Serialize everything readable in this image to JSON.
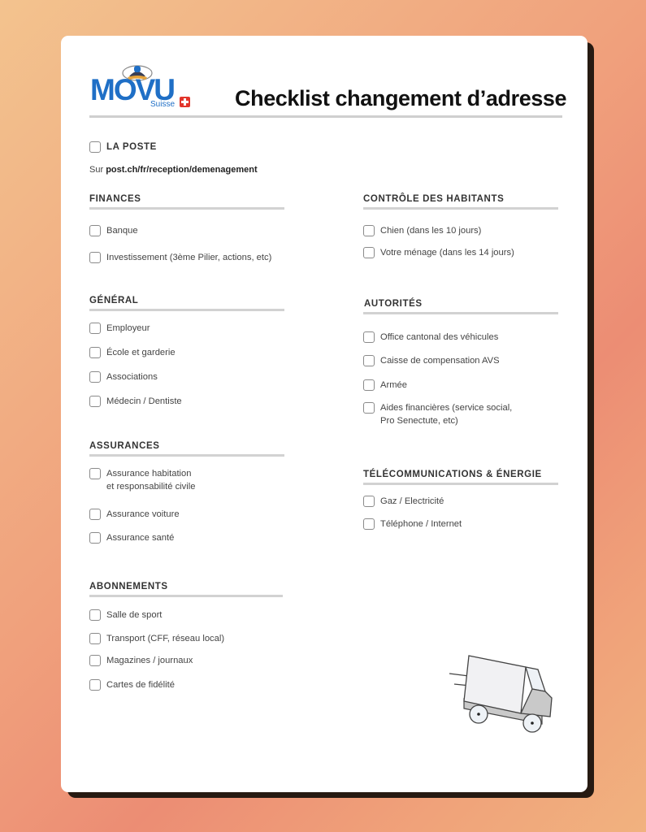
{
  "header": {
    "logo": {
      "brand": "MOVU",
      "sub": "Suisse",
      "brand_color": "#1f6fc6",
      "flag_color": "#e2352b"
    },
    "title": "Checklist changement d’adresse"
  },
  "la_poste": {
    "label": "LA POSTE",
    "note_prefix": "Sur",
    "note_link": "post.ch/fr/reception/demenagement"
  },
  "sections": {
    "finances": {
      "title": "FINANCES",
      "items": [
        "Banque",
        "Investissement (3ème Pilier, actions, etc)"
      ]
    },
    "general": {
      "title": "GÉNÉRAL",
      "items": [
        "Employeur",
        "École et garderie",
        "Associations",
        "Médecin / Dentiste"
      ]
    },
    "assurances": {
      "title": "ASSURANCES",
      "items": [
        "Assurance habitation\net responsabilité civile",
        "Assurance voiture",
        "Assurance santé"
      ]
    },
    "abonnements": {
      "title": "ABONNEMENTS",
      "items": [
        "Salle de sport",
        "Transport (CFF, réseau local)",
        "Magazines / journaux",
        "Cartes de fidélité"
      ]
    },
    "controle": {
      "title": "CONTRÔLE DES HABITANTS",
      "items": [
        "Chien (dans les 10 jours)",
        "Votre ménage (dans les 14 jours)"
      ]
    },
    "autorites": {
      "title": "AUTORITÉS",
      "items": [
        "Office cantonal des véhicules",
        "Caisse de compensation AVS",
        "Armée",
        "Aides financières (service social,\nPro Senectute, etc)"
      ]
    },
    "telecom": {
      "title": "TÉLÉCOMMUNICATIONS & ÉNERGIE",
      "items": [
        "Gaz / Electricité",
        "Téléphone / Internet"
      ]
    }
  },
  "illustration": {
    "icon": "moving-truck-icon"
  }
}
